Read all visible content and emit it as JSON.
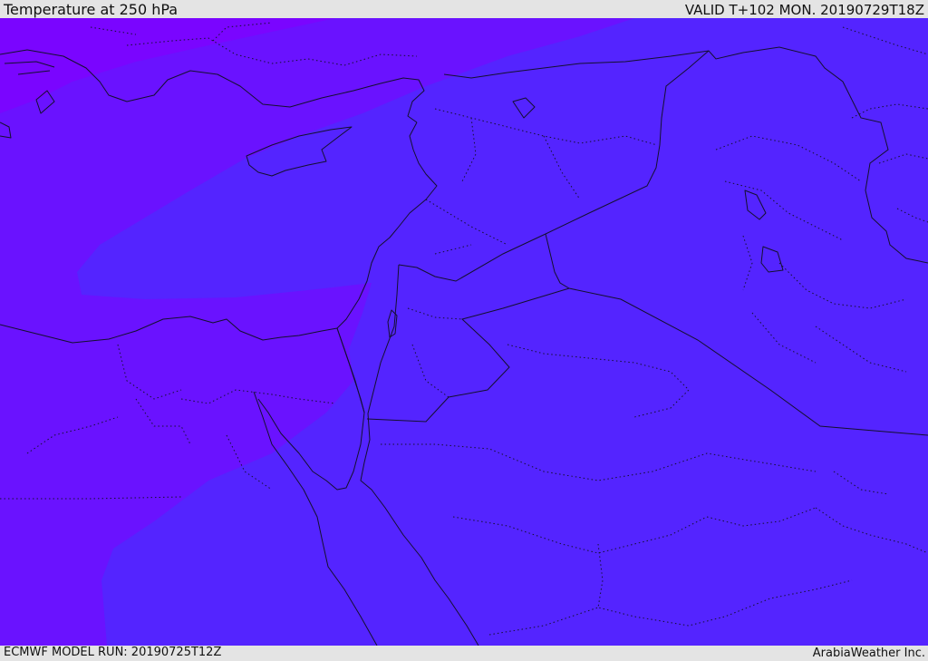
{
  "header": {
    "title": "Temperature at 250 hPa",
    "valid_time": "VALID T+102 MON. 20190729T18Z"
  },
  "footer": {
    "model_run": "ECMWF MODEL RUN: 20190725T12Z",
    "credit": "ArabiaWeather Inc."
  },
  "map": {
    "variable": "temperature",
    "level": "250 hPa",
    "colors": {
      "warmest_band": "#5b26ff",
      "mid_band": "#5424ff",
      "cool_band": "#6a12ff",
      "coldest_band": "#7a05ff",
      "boundary_lines": "#14102e"
    }
  }
}
